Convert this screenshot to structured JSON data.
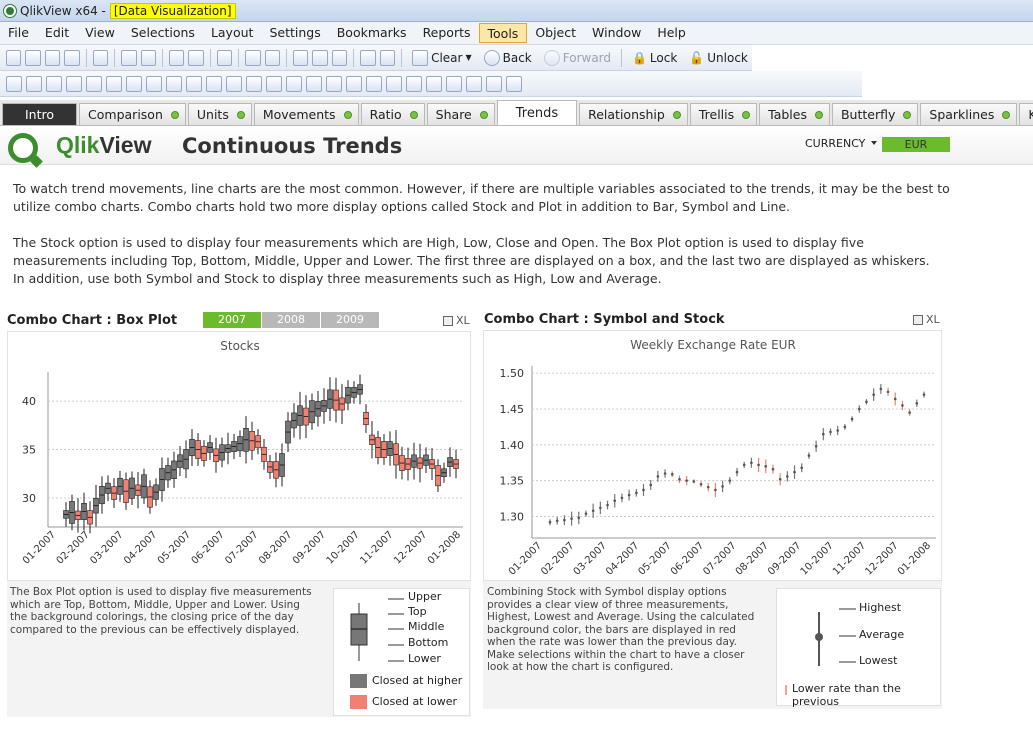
{
  "window": {
    "title": "QlikView x64 - ",
    "doc": "[Data Visualization]"
  },
  "menu": [
    "File",
    "Edit",
    "View",
    "Selections",
    "Layout",
    "Settings",
    "Bookmarks",
    "Reports",
    "Tools",
    "Object",
    "Window",
    "Help"
  ],
  "toolbar": {
    "clear": "Clear",
    "back": "Back",
    "forward": "Forward",
    "lock": "Lock",
    "unlock": "Unlock"
  },
  "tabs": [
    {
      "label": "Intro",
      "style": "dark"
    },
    {
      "label": "Comparison"
    },
    {
      "label": "Units"
    },
    {
      "label": "Movements"
    },
    {
      "label": "Ratio"
    },
    {
      "label": "Share"
    },
    {
      "label": "Trends",
      "style": "selected"
    },
    {
      "label": "Relationship"
    },
    {
      "label": "Trellis"
    },
    {
      "label": "Tables"
    },
    {
      "label": "Butterfly"
    },
    {
      "label": "Sparklines"
    },
    {
      "label": "KPI"
    }
  ],
  "header": {
    "logo_q": "Qlik",
    "logo_v": "View",
    "title": "Continuous Trends",
    "currency_label": "CURRENCY",
    "currency_value": "EUR",
    "accent": "#6cbb2f"
  },
  "intro": {
    "p1": "To watch trend movements, line charts are the most common. However, if there are multiple variables associated to the trends, it may be the best to utilize combo charts. Combo charts hold two more display options called Stock and Plot in addition to Bar, Symbol and Line.",
    "p2": "The Stock option is used to display four measurements which are High, Low, Close and Open. The Box Plot option is used to display five measurements including Top, Bottom, Middle, Upper and Lower. The first three are displayed on a box, and the last two are displayed as whiskers.",
    "p3": "In addition, use both Symbol and Stock to display three measurements such as High, Low and Average."
  },
  "left": {
    "title": "Combo Chart : Box Plot",
    "years": [
      {
        "label": "2007",
        "selected": true
      },
      {
        "label": "2008",
        "selected": false
      },
      {
        "label": "2009",
        "selected": false
      }
    ],
    "xl": "XL",
    "desc": "The Box Plot option is used to display five measurements which are Top, Bottom, Middle, Upper and Lower. Using the background colorings, the closing price of the day compared to the previous can be effectively displayed.",
    "legend": {
      "upper": "Upper",
      "top": "Top",
      "middle": "Middle",
      "bottom": "Bottom",
      "lower": "Lower",
      "higher": "Closed at higher",
      "lower_close": "Closed at lower"
    }
  },
  "right": {
    "title": "Combo Chart : Symbol and Stock",
    "xl": "XL",
    "desc": "Combining Stock with Symbol display options provides a clear view of three measurements, Highest, Lowest and Average. Using the calculated background color, the bars are displayed in red when the rate was lower than the previous day.\nMake selections within the chart to have a closer look at how the chart is configured.",
    "legend": {
      "highest": "Highest",
      "average": "Average",
      "lowest": "Lowest",
      "lower_rate": "Lower rate than the previous"
    }
  },
  "chart_data": [
    {
      "type": "box",
      "title": "Stocks",
      "ylim": [
        27,
        43
      ],
      "yticks": [
        30,
        35,
        40
      ],
      "categories": [
        "01-2007",
        "02-2007",
        "03-2007",
        "04-2007",
        "05-2007",
        "06-2007",
        "07-2007",
        "08-2007",
        "09-2007",
        "10-2007",
        "11-2007",
        "12-2007",
        "01-2008"
      ],
      "closes": [
        28.3,
        28.5,
        28.2,
        28.6,
        28.0,
        29.2,
        30.3,
        31.0,
        30.5,
        31.2,
        30.7,
        31.0,
        30.8,
        31.2,
        30.1,
        30.6,
        31.9,
        32.6,
        32.9,
        33.8,
        34.0,
        35.2,
        35.0,
        34.6,
        35.2,
        34.4,
        34.7,
        35.1,
        35.3,
        35.6,
        36.0,
        35.9,
        35.8,
        34.5,
        33.2,
        32.9,
        33.4,
        36.8,
        38.0,
        38.5,
        38.4,
        38.9,
        39.2,
        39.5,
        40.2,
        40.1,
        39.7,
        40.6,
        40.9,
        41.2,
        38.2,
        36.0,
        35.2,
        35.0,
        35.1,
        34.5,
        33.6,
        33.5,
        33.8,
        33.6,
        33.9,
        33.5,
        32.3,
        32.6,
        33.7,
        33.5
      ],
      "colors": {
        "higher": "#777777",
        "lower": "#f08070"
      },
      "grid": true
    },
    {
      "type": "stock",
      "title": "Weekly Exchange Rate EUR",
      "ylim": [
        1.27,
        1.51
      ],
      "yticks": [
        "1.30",
        "1.35",
        "1.40",
        "1.45",
        "1.50"
      ],
      "categories": [
        "01-2007",
        "02-2007",
        "03-2007",
        "04-2007",
        "05-2007",
        "06-2007",
        "07-2007",
        "08-2007",
        "09-2007",
        "10-2007",
        "11-2007",
        "12-2007",
        "01-2008"
      ],
      "avg": [
        1.292,
        1.294,
        1.295,
        1.297,
        1.298,
        1.304,
        1.308,
        1.312,
        1.316,
        1.322,
        1.326,
        1.33,
        1.333,
        1.337,
        1.344,
        1.356,
        1.36,
        1.359,
        1.352,
        1.35,
        1.349,
        1.345,
        1.341,
        1.337,
        1.342,
        1.35,
        1.362,
        1.372,
        1.375,
        1.372,
        1.37,
        1.366,
        1.352,
        1.356,
        1.362,
        1.368,
        1.385,
        1.398,
        1.415,
        1.418,
        1.42,
        1.425,
        1.436,
        1.45,
        1.46,
        1.47,
        1.478,
        1.474,
        1.464,
        1.455,
        1.445,
        1.458,
        1.47
      ],
      "colors": {
        "up": "#777777",
        "down": "#f08070"
      },
      "grid": true
    }
  ]
}
